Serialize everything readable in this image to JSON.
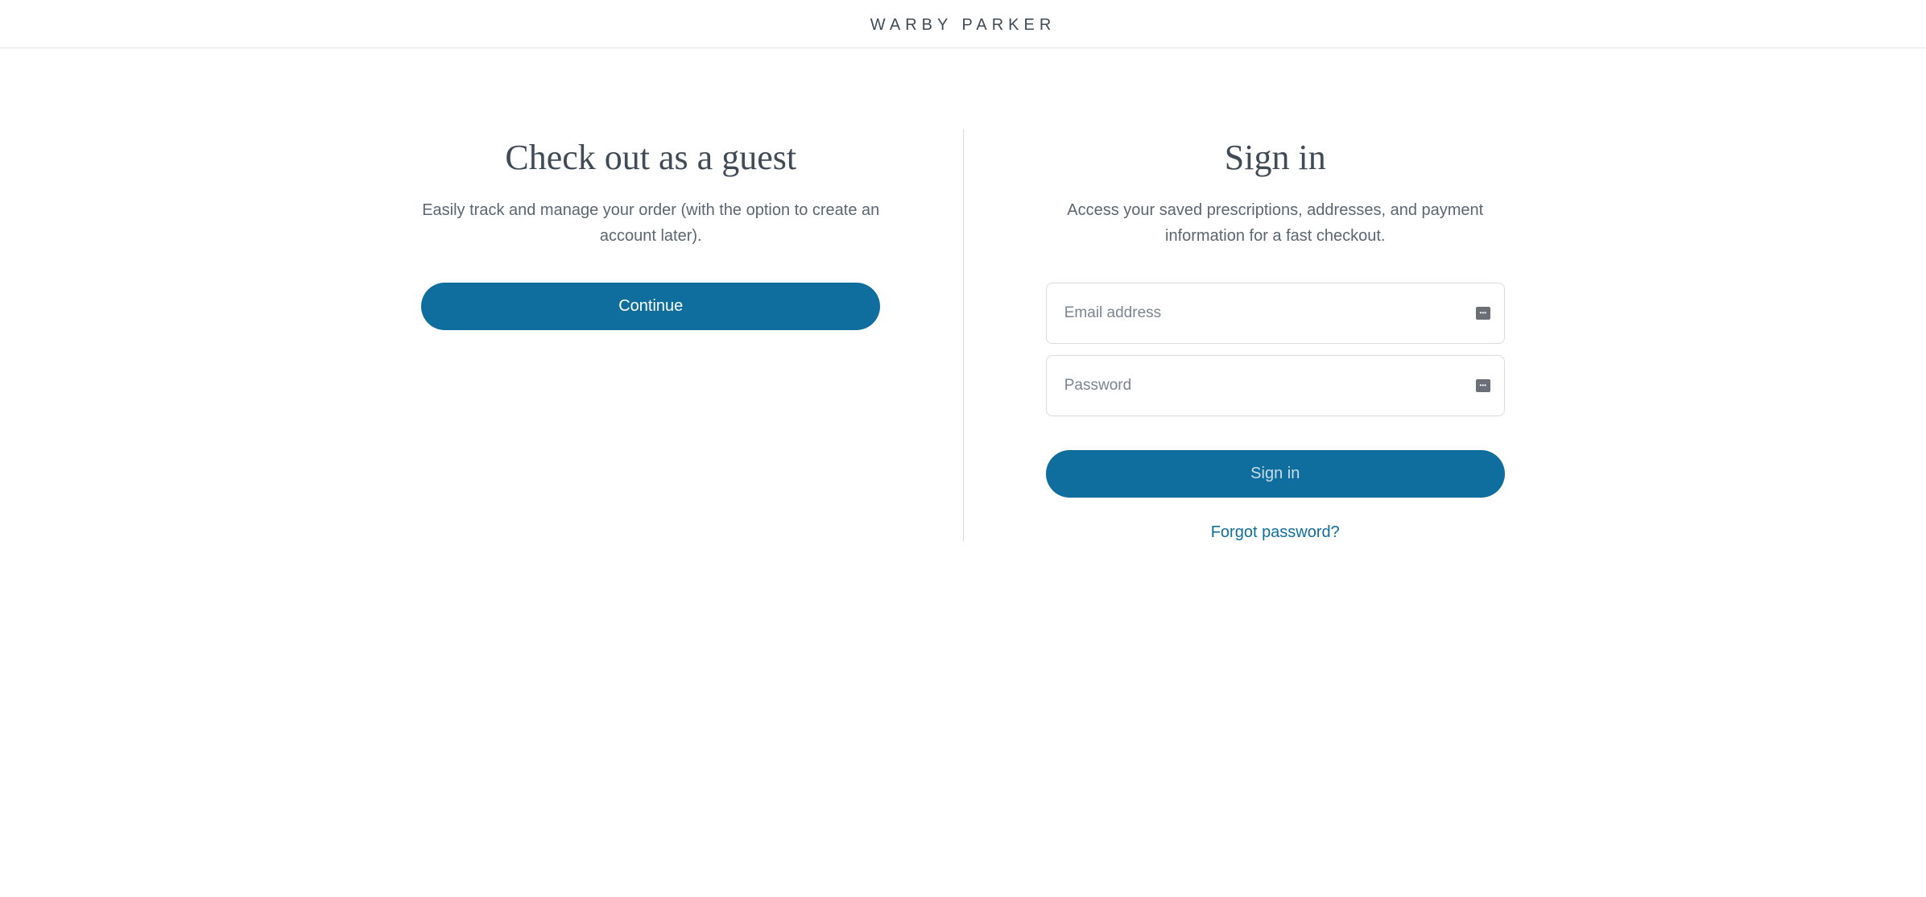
{
  "header": {
    "brand": "WARBY PARKER"
  },
  "guest": {
    "title": "Check out as a guest",
    "subtitle": "Easily track and manage your order (with the option to create an account later).",
    "continue_label": "Continue"
  },
  "signin": {
    "title": "Sign in",
    "subtitle": "Access your saved prescriptions, addresses, and payment information for a fast checkout.",
    "email_placeholder": "Email address",
    "password_placeholder": "Password",
    "signin_label": "Sign in",
    "forgot_label": "Forgot password?"
  }
}
